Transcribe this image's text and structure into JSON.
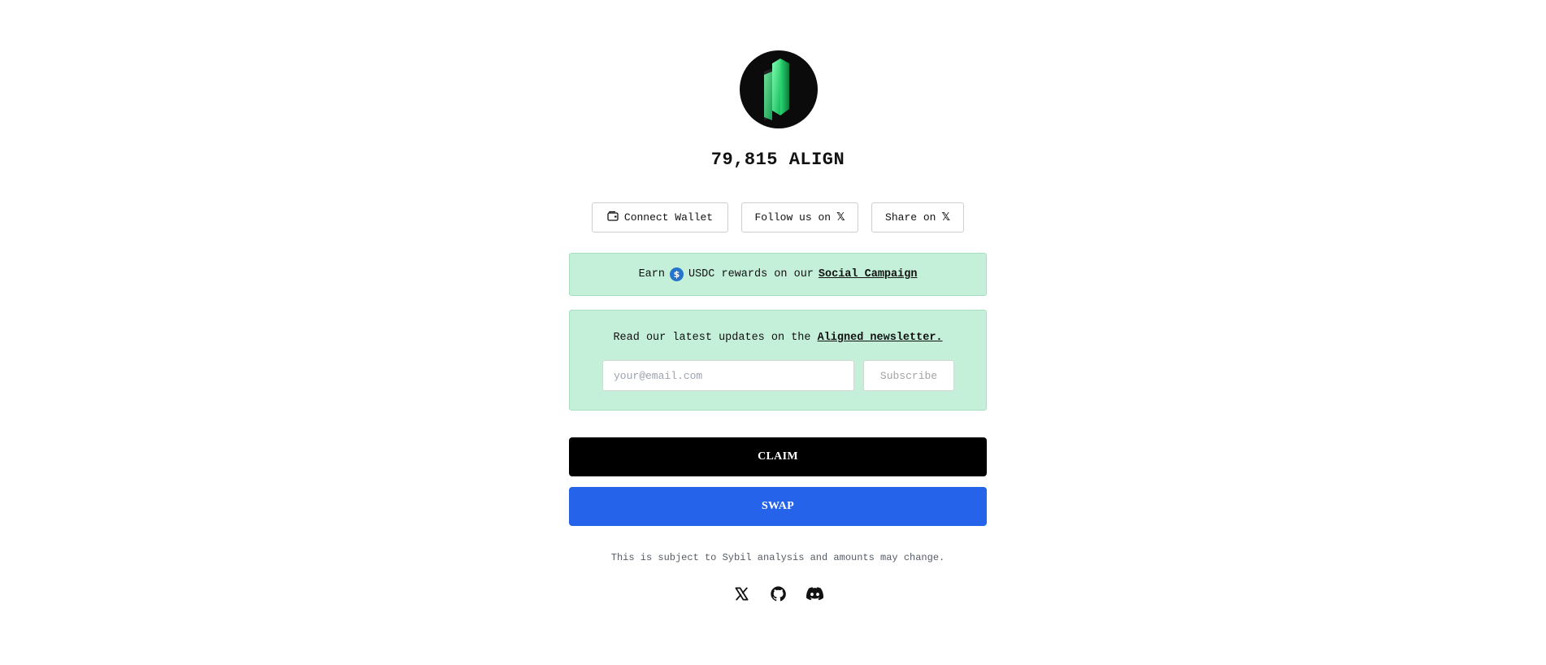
{
  "token": {
    "logo_icon": "align-crystal-logo",
    "amount": "79,815 ALIGN",
    "accent": "#3ef08a"
  },
  "actions": {
    "connect_wallet": "Connect Wallet",
    "follow_on_x": "Follow us on",
    "share_on_x": "Share on",
    "x_glyph": "𝕏"
  },
  "campaign": {
    "prefix": "Earn",
    "token_icon": "usdc-icon",
    "middle": "USDC rewards on our",
    "link": "Social Campaign",
    "background": "#c4f0d9"
  },
  "newsletter": {
    "text": "Read our latest updates on the",
    "link": "Aligned newsletter.",
    "email_placeholder": "your@email.com",
    "email_value": "",
    "subscribe": "Subscribe"
  },
  "buttons": {
    "claim": "CLAIM",
    "claim_color": "#000000",
    "swap": "SWAP",
    "swap_color": "#2563eb"
  },
  "disclaimer": "This is subject to Sybil analysis and amounts may change.",
  "social": [
    {
      "icon": "x-icon"
    },
    {
      "icon": "github-icon"
    },
    {
      "icon": "discord-icon"
    }
  ]
}
